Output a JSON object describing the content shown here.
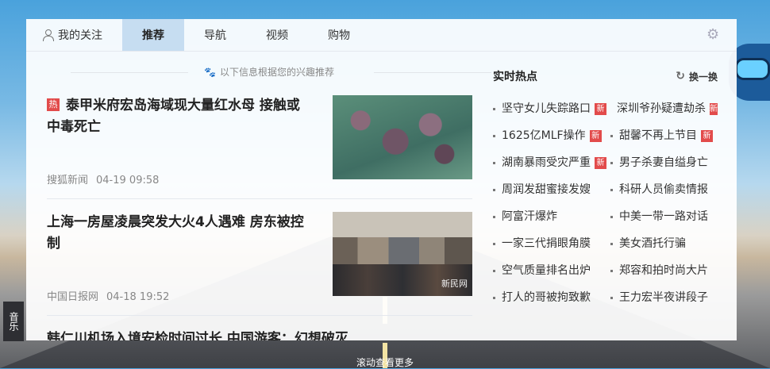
{
  "tabs": [
    {
      "label": "我的关注",
      "icon": "user-icon"
    },
    {
      "label": "推荐"
    },
    {
      "label": "导航"
    },
    {
      "label": "视频"
    },
    {
      "label": "购物"
    }
  ],
  "settings_icon": "gear-icon",
  "hint": "以下信息根据您的兴趣推荐",
  "feed": [
    {
      "tag": "热",
      "title": "泰甲米府宏岛海域现大量红水母 接触或中毒死亡",
      "source": "搜狐新闻",
      "time": "04-19 09:58"
    },
    {
      "title": "上海一房屋凌晨突发大火4人遇难 房东被控制",
      "source": "中国日报网",
      "time": "04-18 19:52",
      "watermark": "新民网"
    },
    {
      "title": "韩仁川机场入境安检时间过长 中国游客：幻想破灭"
    }
  ],
  "hot": {
    "title": "实时热点",
    "refresh": "换一换",
    "items": [
      {
        "text": "坚守女儿失踪路口",
        "new": "新"
      },
      {
        "text": "深圳爷孙疑遭劫杀",
        "new": "新"
      },
      {
        "text": "1625亿MLF操作",
        "new": "新"
      },
      {
        "text": "甜馨不再上节目",
        "new": "新"
      },
      {
        "text": "湖南暴雨受灾严重",
        "new": "新"
      },
      {
        "text": "男子杀妻自缢身亡"
      },
      {
        "text": "周润发甜蜜接发嫂"
      },
      {
        "text": "科研人员偷卖情报"
      },
      {
        "text": "阿富汗爆炸"
      },
      {
        "text": "中美一带一路对话"
      },
      {
        "text": "一家三代捐眼角膜"
      },
      {
        "text": "美女酒托行骗"
      },
      {
        "text": "空气质量排名出炉"
      },
      {
        "text": "郑容和拍时尚大片"
      },
      {
        "text": "打人的哥被拘致歉"
      },
      {
        "text": "王力宏半夜讲段子"
      }
    ]
  },
  "music_tab": "音乐",
  "scroll_hint": "滚动查看更多"
}
